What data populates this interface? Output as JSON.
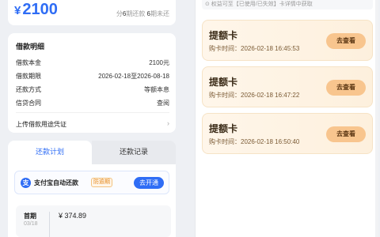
{
  "left": {
    "amount": {
      "currency": "¥",
      "value": "2100"
    },
    "installments": {
      "prefix": "分",
      "count": "6",
      "mid": "期还款 ",
      "unpaid": "6",
      "suffix": "期未还"
    },
    "detail": {
      "title": "借款明细",
      "rows": [
        {
          "label": "借款本金",
          "value": "2100元"
        },
        {
          "label": "借款期限",
          "value": "2026-02-18至2026-08-18"
        },
        {
          "label": "还款方式",
          "value": "等额本息"
        },
        {
          "label": "信贷合同",
          "value": "查阅"
        }
      ],
      "upload_label": "上传借款用途凭证",
      "upload_chevron": "›"
    },
    "tabs": [
      {
        "label": "还款计划",
        "active": true
      },
      {
        "label": "还款记录",
        "active": false
      }
    ],
    "autopay": {
      "icon": "支",
      "text": "支付宝自动还款",
      "badge": "防逾期",
      "button": "去开通"
    },
    "period": {
      "name": "首期",
      "date": "03/18",
      "amount": "¥ 374.89"
    }
  },
  "right": {
    "notice": "⊙ 权益可至【已使用/已失效】卡详情中获取",
    "cards": [
      {
        "title": "提额卡",
        "time": "购卡时间：2026-02-18 16:45:53",
        "button": "去查看"
      },
      {
        "title": "提额卡",
        "time": "购卡时间：2026-02-18 16:47:22",
        "button": "去查看"
      },
      {
        "title": "提额卡",
        "time": "购卡时间：2026-02-18 16:50:40",
        "button": "去查看"
      }
    ]
  },
  "colors": {
    "accent": "#2f6df5",
    "card_gradient": "#fdf0dd",
    "card_button": "#f8c58e"
  }
}
